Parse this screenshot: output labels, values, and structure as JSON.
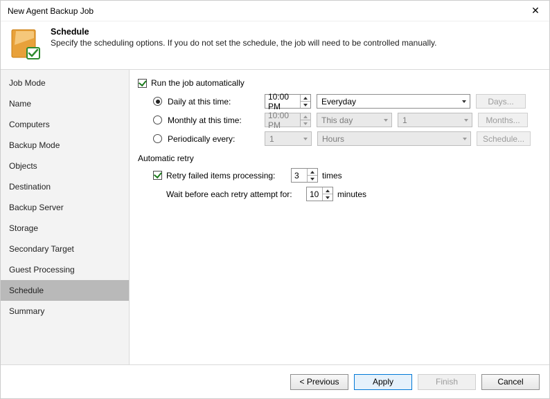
{
  "window": {
    "title": "New Agent Backup Job"
  },
  "header": {
    "heading": "Schedule",
    "subheading": "Specify the scheduling options. If you do not set the schedule, the job will need to be controlled manually."
  },
  "sidebar": {
    "items": [
      {
        "label": "Job Mode"
      },
      {
        "label": "Name"
      },
      {
        "label": "Computers"
      },
      {
        "label": "Backup Mode"
      },
      {
        "label": "Objects"
      },
      {
        "label": "Destination"
      },
      {
        "label": "Backup Server"
      },
      {
        "label": "Storage"
      },
      {
        "label": "Secondary Target"
      },
      {
        "label": "Guest Processing"
      },
      {
        "label": "Schedule"
      },
      {
        "label": "Summary"
      }
    ]
  },
  "schedule": {
    "run_auto_label": "Run the job automatically",
    "daily": {
      "label": "Daily at this time:",
      "time": "10:00 PM",
      "day_select": "Everyday",
      "days_btn": "Days..."
    },
    "monthly": {
      "label": "Monthly at this time:",
      "time": "10:00 PM",
      "ordinal": "This day",
      "day": "1",
      "months_btn": "Months..."
    },
    "periodic": {
      "label": "Periodically every:",
      "value": "1",
      "unit": "Hours",
      "schedule_btn": "Schedule..."
    },
    "retry": {
      "section": "Automatic retry",
      "retry_label": "Retry failed items processing:",
      "retry_count": "3",
      "times": "times",
      "wait_label": "Wait before each retry attempt for:",
      "wait_val": "10",
      "minutes": "minutes"
    }
  },
  "footer": {
    "previous": "< Previous",
    "apply": "Apply",
    "finish": "Finish",
    "cancel": "Cancel"
  }
}
